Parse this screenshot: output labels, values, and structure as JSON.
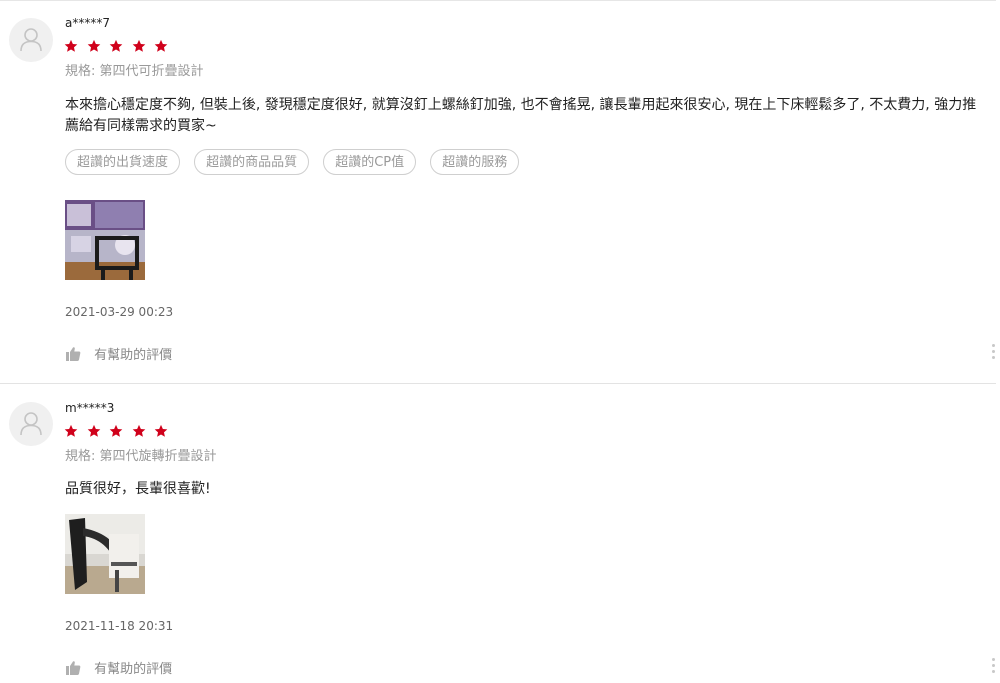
{
  "reviews": [
    {
      "username": "a*****7",
      "rating": 5,
      "variant": "規格: 第四代可折疊設計",
      "comment": "本來擔心穩定度不夠, 但裝上後, 發現穩定度很好, 就算沒釘上螺絲釘加強, 也不會搖晃, 讓長輩用起來很安心, 現在上下床輕鬆多了, 不太費力, 強力推薦給有同樣需求的買家~",
      "tags": [
        "超讚的出貨速度",
        "超讚的商品品質",
        "超讚的CP值",
        "超讚的服務"
      ],
      "date": "2021-03-29 00:23",
      "helpful_label": "有幫助的評價"
    },
    {
      "username": "m*****3",
      "rating": 5,
      "variant": "規格: 第四代旋轉折疊設計",
      "comment": "品質很好，長輩很喜歡!",
      "tags": [],
      "date": "2021-11-18 20:31",
      "helpful_label": "有幫助的評價"
    }
  ],
  "colors": {
    "star": "#d0011b",
    "muted_text": "#9a9a9a",
    "tag_border": "#cfcfcf"
  }
}
